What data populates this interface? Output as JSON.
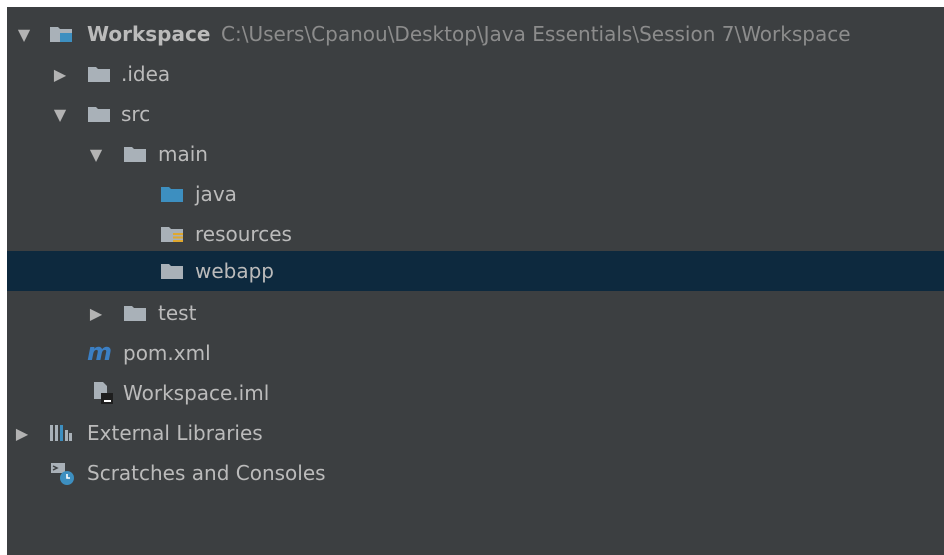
{
  "tree": {
    "root": {
      "label": "Workspace",
      "path": "C:\\Users\\Cpanou\\Desktop\\Java Essentials\\Session 7\\Workspace",
      "expanded_glyph": "▼"
    },
    "idea": {
      "label": ".idea",
      "collapsed_glyph": "▶"
    },
    "src": {
      "label": "src",
      "expanded_glyph": "▼"
    },
    "main": {
      "label": "main",
      "expanded_glyph": "▼"
    },
    "java": {
      "label": "java"
    },
    "resources": {
      "label": "resources"
    },
    "webapp": {
      "label": "webapp",
      "selected": true
    },
    "test": {
      "label": "test",
      "collapsed_glyph": "▶"
    },
    "pom": {
      "label": "pom.xml",
      "icon_letter": "m"
    },
    "iml": {
      "label": "Workspace.iml"
    },
    "ext_libs": {
      "label": "External Libraries",
      "collapsed_glyph": "▶"
    },
    "scratches": {
      "label": "Scratches and Consoles"
    }
  },
  "colors": {
    "panel_bg": "#3c3f41",
    "selection_bg": "#0d293e",
    "text": "#bbbbbb",
    "path_text": "#8c8c8c",
    "folder_gray": "#a9b1b8",
    "folder_blue": "#3d8fc0",
    "maven_blue": "#3b7fc4"
  },
  "icons": {
    "root": "module-folder-icon",
    "folder": "folder-icon",
    "source_folder": "source-folder-icon",
    "resources_folder": "resources-folder-icon",
    "maven": "maven-icon",
    "iml": "module-file-icon",
    "libraries": "libraries-icon",
    "scratches": "scratches-icon"
  }
}
